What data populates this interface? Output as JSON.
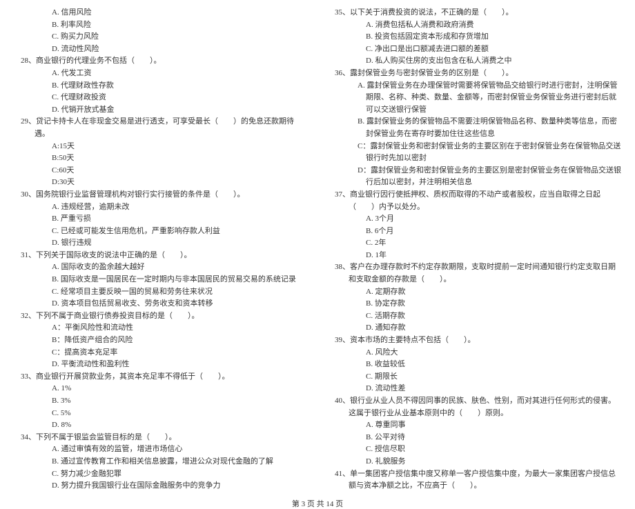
{
  "left": {
    "q27opts": [
      "A. 信用风险",
      "B. 利率风险",
      "C. 购买力风险",
      "D. 流动性风险"
    ],
    "q28": "28、商业银行的代理业务不包括（　　）。",
    "q28opts": [
      "A. 代发工资",
      "B. 代理财政性存款",
      "C. 代理财政投资",
      "D. 代销开放式基金"
    ],
    "q29": "29、贷记卡持卡人在非现金交易是进行透支，可享受最长（　　）的免息还款期待遇。",
    "q29opts": [
      "A:15天",
      "B:50天",
      "C:60天",
      "D:30天"
    ],
    "q30": "30、国务院银行业监督管理机构对银行实行接管的条件是（　　）。",
    "q30opts": [
      "A. 违规经营，逾期未改",
      "B. 严重亏损",
      "C. 已经或可能发生信用危机，严重影响存款人利益",
      "D. 银行违规"
    ],
    "q31": "31、下列关于国际收支的说法中正确的是（　　）。",
    "q31opts": [
      "A. 国际收支的盈余越大越好",
      "B. 国际收支是一国居民在一定时期内与非本国居民的贸易交易的系统记录",
      "C. 经常项目主要反映一国的贸易和劳务往来状况",
      "D. 资本项目包括贸易收支、劳务收支和资本转移"
    ],
    "q32": "32、下列不属于商业银行债券投资目标的是（　　）。",
    "q32opts": [
      "A：平衡风险性和流动性",
      "B：降低资产组合的风险",
      "C：提高资本充足率",
      "D. 平衡流动性和盈利性"
    ],
    "q33": "33、商业银行开展贷款业务，其资本充足率不得低于（　　）。",
    "q33opts": [
      "A. 1%",
      "B. 3%",
      "C. 5%",
      "D. 8%"
    ],
    "q34": "34、下列不属于银监会监管目标的是（　　）。",
    "q34opts": [
      "A. 通过审慎有效的监管，增进市场信心",
      "B. 通过宣传教育工作和相关信息披露，增进公众对现代金融的了解",
      "C. 努力减少金融犯罪",
      "D. 努力提升我国银行业在国际金融服务中的竞争力"
    ]
  },
  "right": {
    "q35": "35、以下关于消费投资的说法，不正确的是（　　）。",
    "q35opts": [
      "A. 消费包括私人消费和政府消费",
      "B. 投资包括固定资本形成和存货增加",
      "C. 净出口是出口额减去进口额的差额",
      "D. 私人购买住房的支出包含在私人消费之中"
    ],
    "q36": "36、露封保管业务与密封保管业务的区别是（　　）。",
    "q36opts": [
      "A. 露封保管业务在办理保管时需要将保管物品交给银行时进行密封，注明保管期限、名称、种类、数量、金额等，而密封保管业务保管业务进行密封后就可以交送银行保管",
      "B. 露封保管业务的保管物品不需要注明保管物品名称、数量种类等信息，而密封保管业务在寄存时要加住往这些信息",
      "C：露封保管业务和密封保管业务的主要区别在于密封保管业务在保管物品交送银行时先加以密封",
      "D：露封保管业务和密封保管业务的主要区别是密封保管业务在保管物品交送银行后加以密封，并注明相关信息"
    ],
    "q37": "37、商业银行因行使抵押权、质权而取得的不动产或者股权，应当自取得之日起（　　）内予以处分。",
    "q37opts": [
      "A. 3个月",
      "B. 6个月",
      "C. 2年",
      "D. 1年"
    ],
    "q38": "38、客户在办理存款时不约定存款期限，支取时提前一定时间通知银行约定支取日期和支取金额的存款是（　　）。",
    "q38opts": [
      "A. 定期存款",
      "B. 协定存款",
      "C. 活期存款",
      "D. 通知存款"
    ],
    "q39": "39、资本市场的主要特点不包括（　　）。",
    "q39opts": [
      "A. 风险大",
      "B. 收益较低",
      "C. 期限长",
      "D. 流动性差"
    ],
    "q40": "40、银行业从业人员不得因同事的民族、肤色、性别，而对其进行任何形式的侵害。这属于银行业从业基本原则中的（　　）原则。",
    "q40opts": [
      "A. 尊重同事",
      "B. 公平对待",
      "C. 授信尽职",
      "D. 礼貌服务"
    ],
    "q41": "41、单一集团客户授信集中度又称单一客户授信集中度，为最大一家集团客户授信总额与资本净额之比，不应高于（　　）。"
  },
  "footer": "第 3 页 共 14 页"
}
